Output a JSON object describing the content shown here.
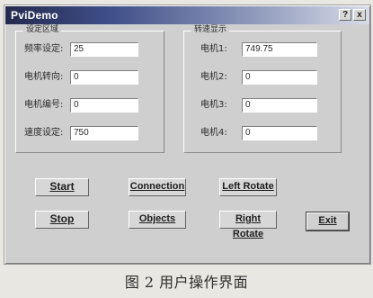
{
  "window": {
    "title": "PviDemo",
    "help_label": "?",
    "close_label": "x"
  },
  "settings_group": {
    "title": "设定区域",
    "rows": [
      {
        "label": "频率设定:",
        "value": "25"
      },
      {
        "label": "电机转向:",
        "value": "0"
      },
      {
        "label": "电机编号:",
        "value": "0"
      },
      {
        "label": "速度设定:",
        "value": "750"
      }
    ]
  },
  "speed_group": {
    "title": "转速显示",
    "rows": [
      {
        "label": "电机1:",
        "value": "749.75"
      },
      {
        "label": "电机2:",
        "value": "0"
      },
      {
        "label": "电机3:",
        "value": "0"
      },
      {
        "label": "电机4:",
        "value": "0"
      }
    ]
  },
  "buttons": {
    "start": "Start",
    "connection": "Connection",
    "left_rotate": "Left Rotate",
    "stop": "Stop",
    "objects": "Objects",
    "right_rotate": "Right Rotate",
    "exit": "Exit"
  },
  "caption": "图 2  用户操作界面"
}
